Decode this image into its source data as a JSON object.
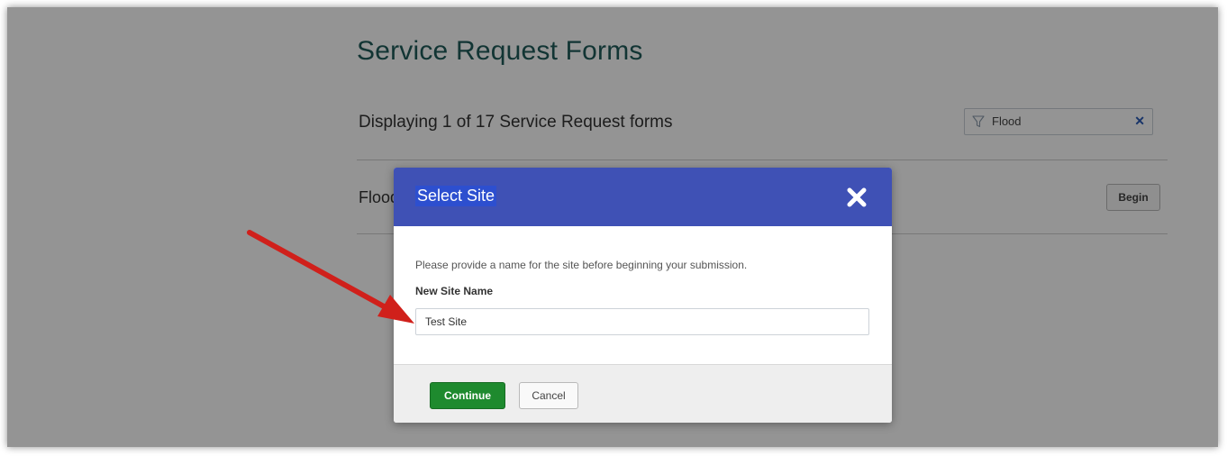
{
  "page": {
    "title": "Service Request Forms",
    "count_text": "Displaying 1 of 17 Service Request forms",
    "filter": {
      "value": "Flood",
      "icon": "filter-icon",
      "clear_icon": "clear-icon"
    },
    "rows": [
      {
        "label": "Flood",
        "action": "Begin"
      }
    ]
  },
  "modal": {
    "title": "Select Site",
    "close_icon": "close-icon",
    "prompt": "Please provide a name for the site before beginning your submission.",
    "field_label": "New Site Name",
    "field_value": "Test Site",
    "continue_label": "Continue",
    "cancel_label": "Cancel"
  },
  "colors": {
    "title_teal": "#1f5c5a",
    "modal_header": "#3f51b5",
    "continue_green": "#1e8a2e",
    "annotation_arrow": "#d0201b"
  }
}
